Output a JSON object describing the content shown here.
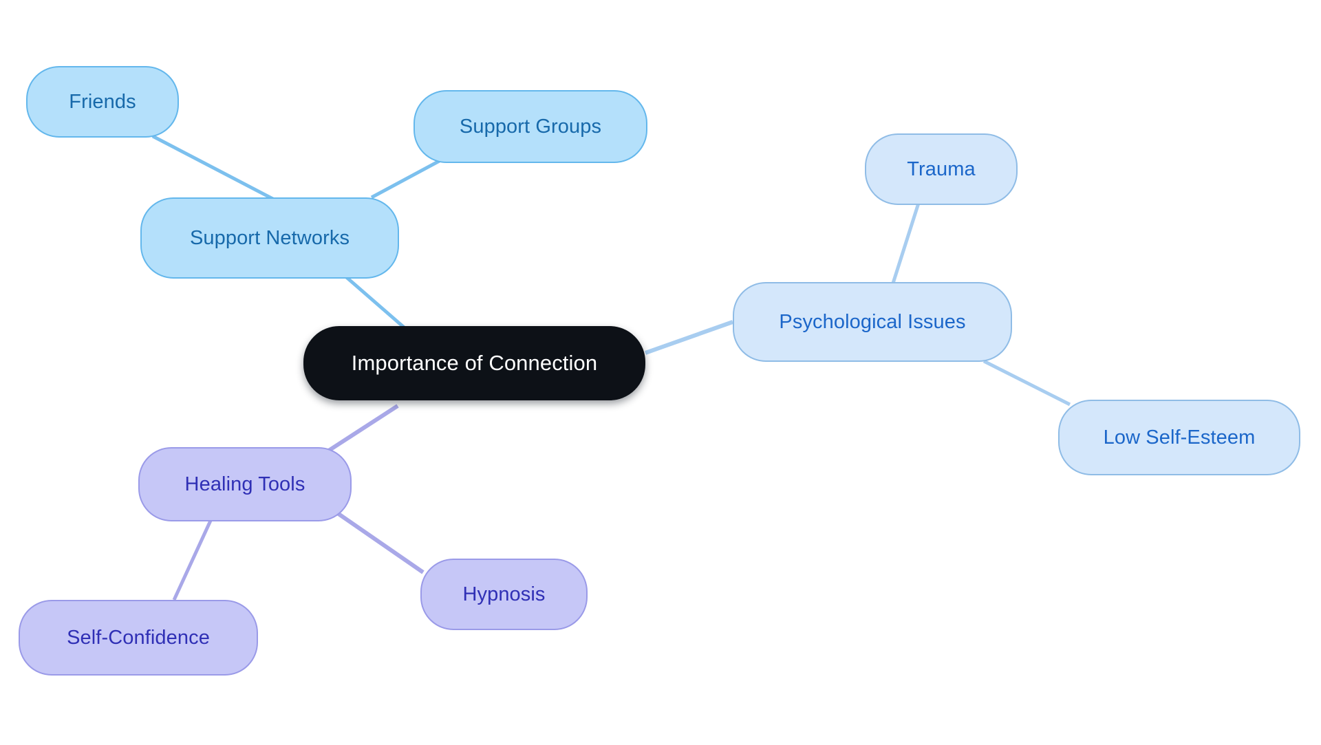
{
  "diagram": {
    "type": "mind-map",
    "title": "Importance of Connection",
    "background_color": "#ffffff"
  },
  "palette": {
    "root_fill": "#0d1117",
    "root_text": "#ffffff",
    "blue_fill": "#b4e0fb",
    "blue_border": "#63b7ec",
    "blue_text": "#1769aa",
    "blue_edge": "#7cc0ee",
    "paleblue_fill": "#d4e7fb",
    "paleblue_border": "#8fbce6",
    "paleblue_text": "#1b66c9",
    "paleblue_edge": "#a8cdf0",
    "purple_fill": "#c6c7f7",
    "purple_border": "#9a9ae8",
    "purple_text": "#2f2fb5",
    "purple_edge": "#a9a8e8"
  },
  "nodes": {
    "root": {
      "label": "Importance of Connection"
    },
    "support_networks": {
      "label": "Support Networks"
    },
    "friends": {
      "label": "Friends"
    },
    "support_groups": {
      "label": "Support Groups"
    },
    "psychological_issues": {
      "label": "Psychological Issues"
    },
    "trauma": {
      "label": "Trauma"
    },
    "low_self_esteem": {
      "label": "Low Self-Esteem"
    },
    "healing_tools": {
      "label": "Healing Tools"
    },
    "hypnosis": {
      "label": "Hypnosis"
    },
    "self_confidence": {
      "label": "Self-Confidence"
    }
  },
  "branches": [
    {
      "name": "support-networks",
      "parent": "Support Networks",
      "children": [
        "Friends",
        "Support Groups"
      ]
    },
    {
      "name": "psychological-issues",
      "parent": "Psychological Issues",
      "children": [
        "Trauma",
        "Low Self-Esteem"
      ]
    },
    {
      "name": "healing-tools",
      "parent": "Healing Tools",
      "children": [
        "Hypnosis",
        "Self-Confidence"
      ]
    }
  ],
  "edges": [
    {
      "from": "Importance of Connection",
      "to": "Support Networks"
    },
    {
      "from": "Support Networks",
      "to": "Friends"
    },
    {
      "from": "Support Networks",
      "to": "Support Groups"
    },
    {
      "from": "Importance of Connection",
      "to": "Psychological Issues"
    },
    {
      "from": "Psychological Issues",
      "to": "Trauma"
    },
    {
      "from": "Psychological Issues",
      "to": "Low Self-Esteem"
    },
    {
      "from": "Importance of Connection",
      "to": "Healing Tools"
    },
    {
      "from": "Healing Tools",
      "to": "Hypnosis"
    },
    {
      "from": "Healing Tools",
      "to": "Self-Confidence"
    }
  ]
}
